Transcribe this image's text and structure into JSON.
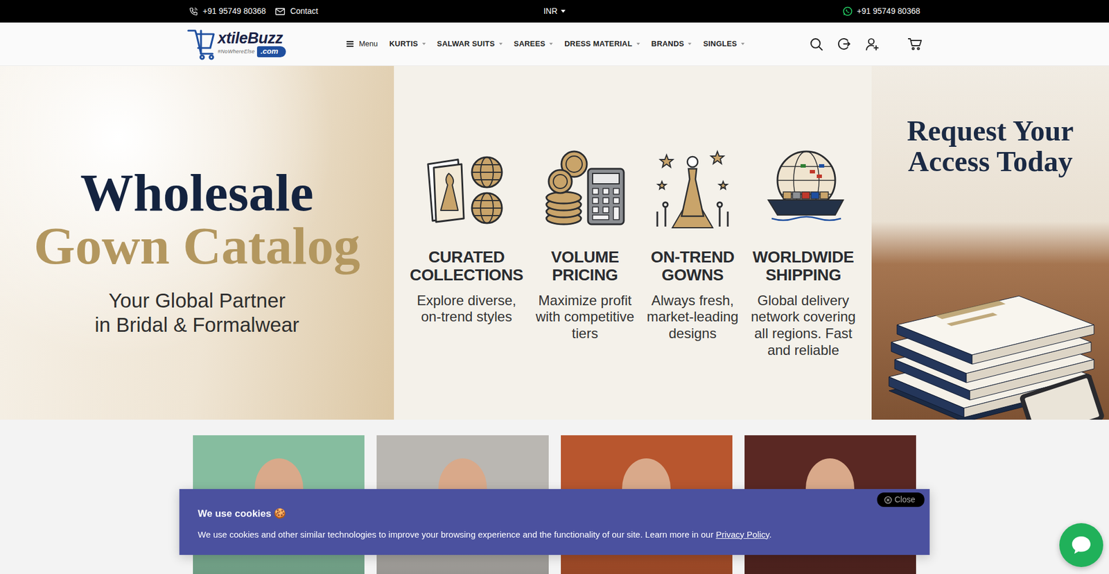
{
  "topbar": {
    "phone": "+91 95749 80368",
    "contact": "Contact",
    "currency": "INR",
    "whatsapp": "+91 95749 80368"
  },
  "logo": {
    "name": "xtileBuzz",
    "domain": ".com",
    "tagline": "#NoWhereElse"
  },
  "nav": {
    "menu": "Menu",
    "items": [
      {
        "label": "KURTIS"
      },
      {
        "label": "SALWAR SUITS"
      },
      {
        "label": "SAREES"
      },
      {
        "label": "DRESS MATERIAL"
      },
      {
        "label": "BRANDS"
      },
      {
        "label": "SINGLES"
      }
    ]
  },
  "hero": {
    "headline": [
      "Wholesale",
      "Gown Catalog"
    ],
    "subtitle": [
      "Your Global Partner",
      "in Bridal & Formalwear"
    ],
    "features": [
      {
        "title": [
          "CURATED",
          "COLLECTIONS"
        ],
        "text": [
          "Explore diverse,",
          "on-trend styles"
        ]
      },
      {
        "title": [
          "VOLUME",
          "PRICING"
        ],
        "text": [
          "Maximize profit",
          "with competitive",
          "tiers"
        ]
      },
      {
        "title": [
          "ON-TREND",
          "GOWNS"
        ],
        "text": [
          "Always fresh,",
          "market-leading",
          "designs"
        ]
      },
      {
        "title": [
          "WORLDWIDE",
          "SHIPPING"
        ],
        "text": [
          "Global delivery",
          "network covering",
          "all regions. Fast",
          "and reliable"
        ]
      }
    ],
    "cta": [
      "Request Your",
      "Access Today"
    ]
  },
  "products": [
    {
      "color": "#86bd9f"
    },
    {
      "color": "#bab7b2"
    },
    {
      "color": "#b8562e"
    },
    {
      "color": "#5a2823"
    }
  ],
  "cookie": {
    "title": "We use cookies 🍪",
    "text": "We use cookies and other similar technologies to improve your browsing experience and the functionality of our site. Learn more in our ",
    "link": "Privacy Policy",
    "end": ".",
    "close": "Close"
  }
}
